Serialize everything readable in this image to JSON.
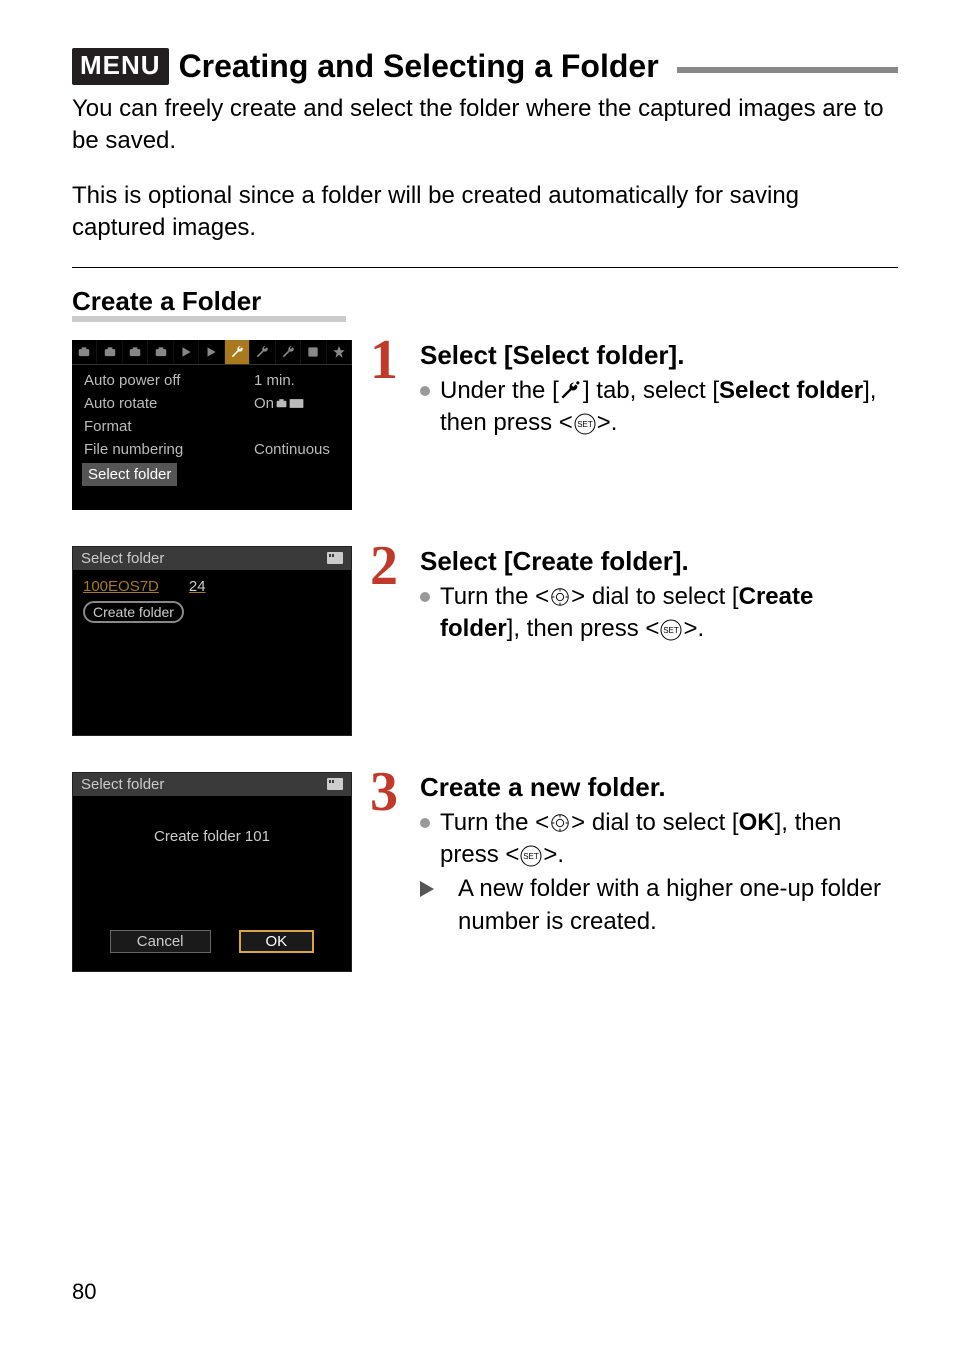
{
  "title": {
    "menu_label": "MENU",
    "text": "Creating and Selecting a Folder"
  },
  "intro_p1": "You can freely create and select the folder where the captured images are to be saved.",
  "intro_p2": "This is optional since a folder will be created automatically for saving captured images.",
  "section_heading": "Create a Folder",
  "steps": {
    "s1": {
      "num": "1",
      "title": "Select [Select folder].",
      "bullet_pre": "Under the [",
      "bullet_mid": "] tab, select [",
      "bullet_sel": "Select folder",
      "bullet_post": "], then press <",
      "bullet_end": ">."
    },
    "s2": {
      "num": "2",
      "title": "Select [Create folder].",
      "bullet_pre": "Turn the <",
      "bullet_mid": "> dial to select [",
      "bullet_sel": "Create folder",
      "bullet_post": "], then press <",
      "bullet_end": ">."
    },
    "s3": {
      "num": "3",
      "title": "Create a new folder.",
      "b1_pre": "Turn the <",
      "b1_mid": "> dial to select [",
      "b1_sel": "OK",
      "b1_post": "], then press <",
      "b1_end": ">.",
      "b2": "A new folder with a higher one-up folder number is created."
    }
  },
  "shot1": {
    "items": {
      "auto_power_off_label": "Auto power off",
      "auto_power_off_value": "1 min.",
      "auto_rotate_label": "Auto rotate",
      "auto_rotate_value": "On",
      "format_label": "Format",
      "file_numbering_label": "File numbering",
      "file_numbering_value": "Continuous",
      "select_folder_label": "Select folder"
    }
  },
  "shot2": {
    "header": "Select folder",
    "folder_name": "100EOS7D",
    "folder_count": "24",
    "create_label": "Create folder"
  },
  "shot3": {
    "header": "Select folder",
    "message": "Create folder 101",
    "cancel": "Cancel",
    "ok": "OK"
  },
  "page_number": "80"
}
